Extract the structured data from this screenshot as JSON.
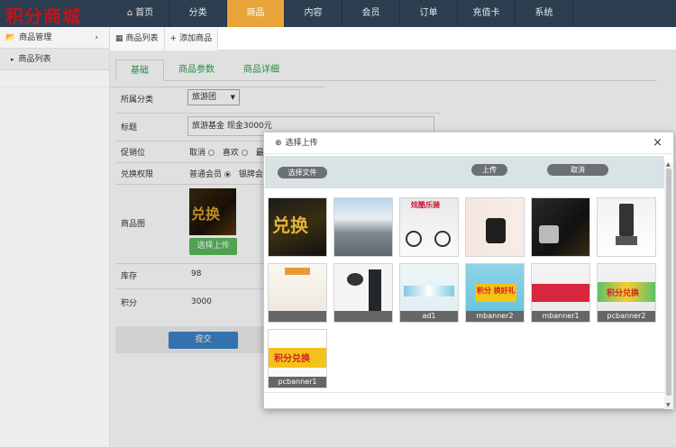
{
  "logo": "积分商城",
  "nav": [
    {
      "label": "首页",
      "icon": "home-icon"
    },
    {
      "label": "分类"
    },
    {
      "label": "商品",
      "active": true
    },
    {
      "label": "内容"
    },
    {
      "label": "会员"
    },
    {
      "label": "订单"
    },
    {
      "label": "充值卡"
    },
    {
      "label": "系统"
    }
  ],
  "sidebar": {
    "group": "商品管理",
    "items": [
      {
        "label": "商品列表"
      }
    ]
  },
  "toptabs": [
    {
      "label": "商品列表",
      "icon": "grid-icon"
    },
    {
      "label": "添加商品",
      "icon": "plus-icon"
    }
  ],
  "subtabs": [
    {
      "label": "基础",
      "active": true
    },
    {
      "label": "商品参数"
    },
    {
      "label": "商品详细"
    }
  ],
  "form": {
    "category_label": "所属分类",
    "category_value": "旅游团",
    "title_label": "标题",
    "title_value": "旅游基金 现金3000元",
    "promo_label": "促销位",
    "promo_options": [
      "取消",
      "喜欢",
      "最"
    ],
    "exchange_label": "兑换权限",
    "exchange_options": [
      "普通会员",
      "银牌会"
    ],
    "image_label": "商品图",
    "image_text": "兑换",
    "upload_label": "选择上传",
    "stock_label": "库存",
    "stock_value": "98",
    "points_label": "积分",
    "points_value": "3000",
    "submit_label": "提交"
  },
  "modal": {
    "title": "选择上传",
    "choose_file": "选择文件",
    "upload": "上传",
    "cancel": "取消",
    "close": "×",
    "images": [
      {
        "caption": "",
        "text": "兑换"
      },
      {
        "caption": ""
      },
      {
        "caption": "",
        "text": "炫酷乐骑"
      },
      {
        "caption": ""
      },
      {
        "caption": ""
      },
      {
        "caption": ""
      },
      {
        "caption": ""
      },
      {
        "caption": ""
      },
      {
        "caption": "ad1"
      },
      {
        "caption": "mbanner2",
        "text": "积分 换好礼"
      },
      {
        "caption": "mbanner1"
      },
      {
        "caption": "pcbanner2",
        "text": "积分兑换"
      },
      {
        "caption": "pcbanner1",
        "text": "积分兑换"
      }
    ]
  }
}
